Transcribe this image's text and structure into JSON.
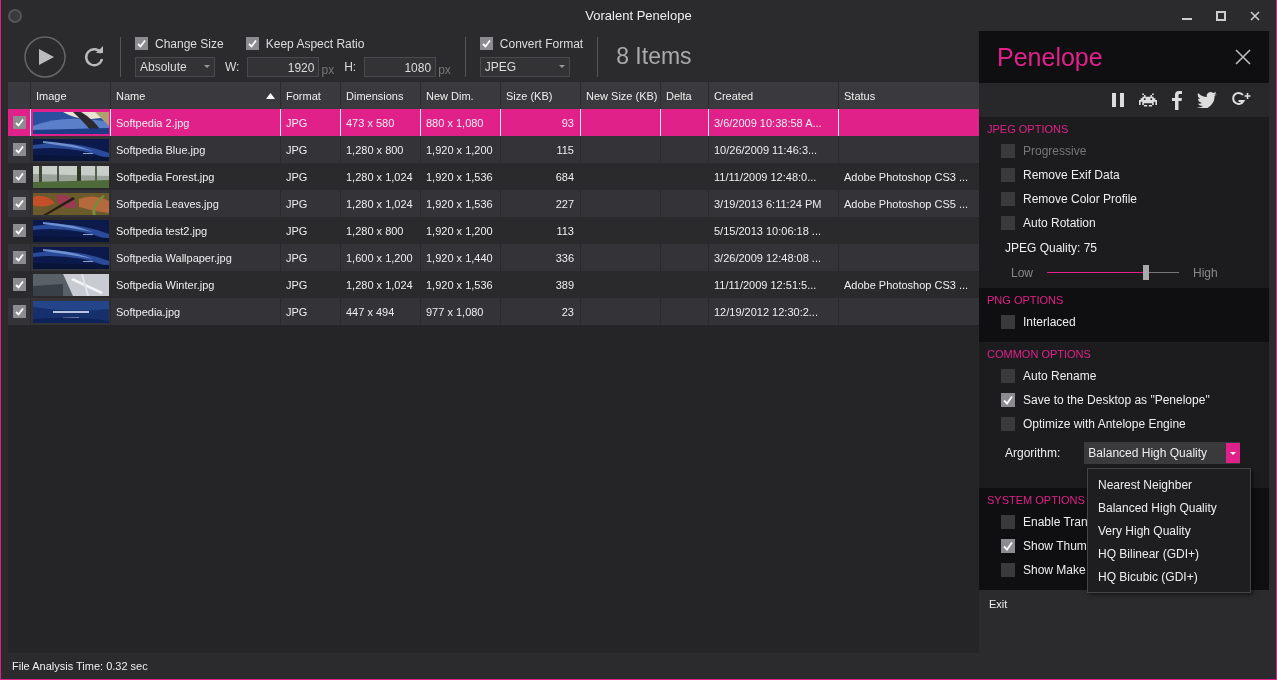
{
  "window": {
    "title": "Voralent Penelope"
  },
  "toolbar": {
    "change_size": {
      "label": "Change Size",
      "checked": true
    },
    "keep_aspect": {
      "label": "Keep Aspect Ratio",
      "checked": true
    },
    "resize_mode": {
      "value": "Absolute"
    },
    "width": {
      "label": "W:",
      "value": "1920",
      "unit": "px"
    },
    "height": {
      "label": "H:",
      "value": "1080",
      "unit": "px"
    },
    "convert_format": {
      "label": "Convert Format",
      "checked": true
    },
    "format": {
      "value": "JPEG"
    },
    "item_count": "8 Items"
  },
  "table": {
    "columns": [
      {
        "label": "Image",
        "sorted": false
      },
      {
        "label": "Name",
        "sorted": true
      },
      {
        "label": "Format",
        "sorted": false
      },
      {
        "label": "Dimensions",
        "sorted": false
      },
      {
        "label": "New Dim.",
        "sorted": false
      },
      {
        "label": "Size (KB)",
        "sorted": false
      },
      {
        "label": "New Size (KB)",
        "sorted": false
      },
      {
        "label": "Delta",
        "sorted": false
      },
      {
        "label": "Created",
        "sorted": false
      },
      {
        "label": "Status",
        "sorted": false
      }
    ],
    "rows": [
      {
        "checked": true,
        "selected": true,
        "name": "Softpedia 2.jpg",
        "format": "JPG",
        "dimensions": "473 x 580",
        "new_dim": "880 x 1,080",
        "size": "93",
        "created": "3/6/2009 10:38:58 A..."
      },
      {
        "checked": true,
        "selected": false,
        "name": "Softpedia Blue.jpg",
        "format": "JPG",
        "dimensions": "1,280 x 800",
        "new_dim": "1,920 x 1,200",
        "size": "115",
        "created": "10/26/2009 11:46:3..."
      },
      {
        "checked": true,
        "selected": false,
        "name": "Softpedia Forest.jpg",
        "format": "JPG",
        "dimensions": "1,280 x 1,024",
        "new_dim": "1,920 x 1,536",
        "size": "684",
        "created": "11/11/2009 12:48:0...",
        "status": "Adobe Photoshop CS3 ..."
      },
      {
        "checked": true,
        "selected": false,
        "name": "Softpedia Leaves.jpg",
        "format": "JPG",
        "dimensions": "1,280 x 1,024",
        "new_dim": "1,920 x 1,536",
        "size": "227",
        "created": "3/19/2013 6:11:24 PM",
        "status": "Adobe Photoshop CS5 ..."
      },
      {
        "checked": true,
        "selected": false,
        "name": "Softpedia test2.jpg",
        "format": "JPG",
        "dimensions": "1,280 x 800",
        "new_dim": "1,920 x 1,200",
        "size": "113",
        "created": "5/15/2013 10:06:18 ..."
      },
      {
        "checked": true,
        "selected": false,
        "name": "Softpedia Wallpaper.jpg",
        "format": "JPG",
        "dimensions": "1,600 x 1,200",
        "new_dim": "1,920 x 1,440",
        "size": "336",
        "created": "3/26/2009 12:48:08 ..."
      },
      {
        "checked": true,
        "selected": false,
        "name": "Softpedia Winter.jpg",
        "format": "JPG",
        "dimensions": "1,280 x 1,024",
        "new_dim": "1,920 x 1,536",
        "size": "389",
        "created": "11/11/2009 12:51:5...",
        "status": "Adobe Photoshop CS3 ..."
      },
      {
        "checked": true,
        "selected": false,
        "name": "Softpedia.jpg",
        "format": "JPG",
        "dimensions": "447 x 494",
        "new_dim": "977 x 1,080",
        "size": "23",
        "created": "12/19/2012 12:30:2..."
      }
    ]
  },
  "panel": {
    "title": "Penelope",
    "sections": [
      {
        "title": "JPEG OPTIONS",
        "options": [
          {
            "label": "Progressive",
            "checked": false,
            "disabled": true
          },
          {
            "label": "Remove Exif Data",
            "checked": false,
            "disabled": false
          },
          {
            "label": "Remove Color Profile",
            "checked": false,
            "disabled": false
          },
          {
            "label": "Auto Rotation",
            "checked": false,
            "disabled": false
          }
        ],
        "quality": {
          "label": "JPEG Quality: 75",
          "low": "Low",
          "high": "High",
          "level": 0.75
        }
      },
      {
        "title": "PNG OPTIONS",
        "options": [
          {
            "label": "Interlaced",
            "checked": false,
            "disabled": false
          }
        ]
      },
      {
        "title": "COMMON OPTIONS",
        "options": [
          {
            "label": "Auto Rename",
            "checked": false,
            "disabled": false
          },
          {
            "label": "Save to the Desktop as \"Penelope\"",
            "checked": true,
            "disabled": false
          },
          {
            "label": "Optimize with Antelope Engine",
            "checked": false,
            "disabled": false
          }
        ],
        "algorithm": {
          "label": "Argorithm:",
          "value": "Balanced High Quality",
          "open": true,
          "options": [
            "Nearest Neighber",
            "Balanced High Quality",
            "Very High Quality",
            "HQ Bilinear (GDI+)",
            "HQ Bicubic (GDI+)"
          ]
        }
      },
      {
        "title": "SYSTEM OPTIONS",
        "options": [
          {
            "label": "Enable Tran",
            "checked": false,
            "disabled": false
          },
          {
            "label": "Show Thum",
            "checked": true,
            "disabled": false
          },
          {
            "label": "Show Make",
            "checked": false,
            "disabled": false
          }
        ]
      }
    ],
    "exit": "Exit"
  },
  "status_bar": "File Analysis Time: 0.32 sec"
}
